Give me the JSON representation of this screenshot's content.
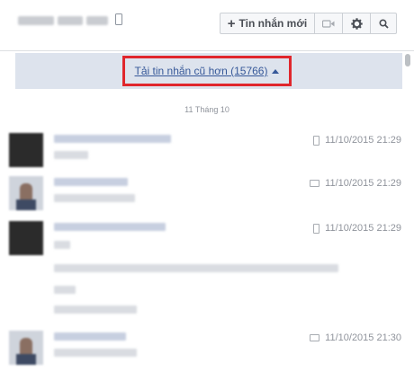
{
  "header": {
    "new_message_label": "Tin nhắn mới",
    "plus": "+",
    "video_icon": "video-camera-icon",
    "gear_icon": "gear-icon",
    "search_icon": "search-icon"
  },
  "load_older": {
    "label": "Tải tin nhắn cũ hơn (15766)",
    "highlight_color": "#e0262c"
  },
  "date_separator": "11 Tháng 10",
  "messages": [
    {
      "timestamp": "11/10/2015 21:29",
      "device": "mobile-icon"
    },
    {
      "timestamp": "11/10/2015 21:29",
      "device": "chat-icon"
    },
    {
      "timestamp": "11/10/2015 21:29",
      "device": "mobile-icon"
    },
    {
      "timestamp": "11/10/2015 21:30",
      "device": "chat-icon"
    }
  ]
}
